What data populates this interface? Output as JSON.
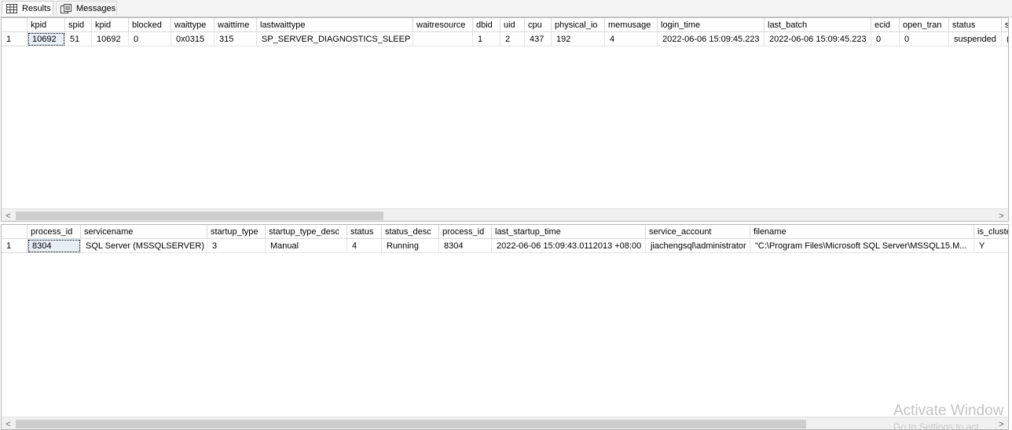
{
  "tabs": {
    "results_label": "Results",
    "messages_label": "Messages"
  },
  "grid1": {
    "columns": [
      "kpid",
      "spid",
      "kpid",
      "blocked",
      "waittype",
      "waittime",
      "lastwaittype",
      "waitresource",
      "dbid",
      "uid",
      "cpu",
      "physical_io",
      "memusage",
      "login_time",
      "last_batch",
      "ecid",
      "open_tran",
      "status",
      "s"
    ],
    "rows": [
      {
        "rownum": "1",
        "cells": [
          "10692",
          "51",
          "10692",
          "0",
          "0x0315",
          "315",
          "SP_SERVER_DIAGNOSTICS_SLEEP",
          "",
          "1",
          "2",
          "437",
          "192",
          "4",
          "2022-06-06 15:09:45.223",
          "2022-06-06 15:09:45.223",
          "0",
          "0",
          "suspended",
          "("
        ]
      }
    ]
  },
  "grid2": {
    "columns": [
      "process_id",
      "servicename",
      "startup_type",
      "startup_type_desc",
      "status",
      "status_desc",
      "process_id",
      "last_startup_time",
      "service_account",
      "filename",
      "is_cluste"
    ],
    "rows": [
      {
        "rownum": "1",
        "cells": [
          "8304",
          "SQL Server (MSSQLSERVER)",
          "3",
          "Manual",
          "4",
          "Running",
          "8304",
          "2022-06-06 15:09:43.0112013 +08:00",
          "jiachengsql\\administrator",
          "\"C:\\Program Files\\Microsoft SQL Server\\MSSQL15.M...",
          "Y"
        ]
      }
    ]
  },
  "scroll": {
    "left_arrow": "<",
    "right_arrow": ">",
    "grid1_thumb_fraction": 0.37,
    "grid2_thumb_fraction": 0.79
  },
  "watermark": {
    "line1": "Activate Window",
    "line2": "Go to Settings to act"
  },
  "icons": {
    "results": "grid-table-icon",
    "messages": "messages-icon"
  }
}
